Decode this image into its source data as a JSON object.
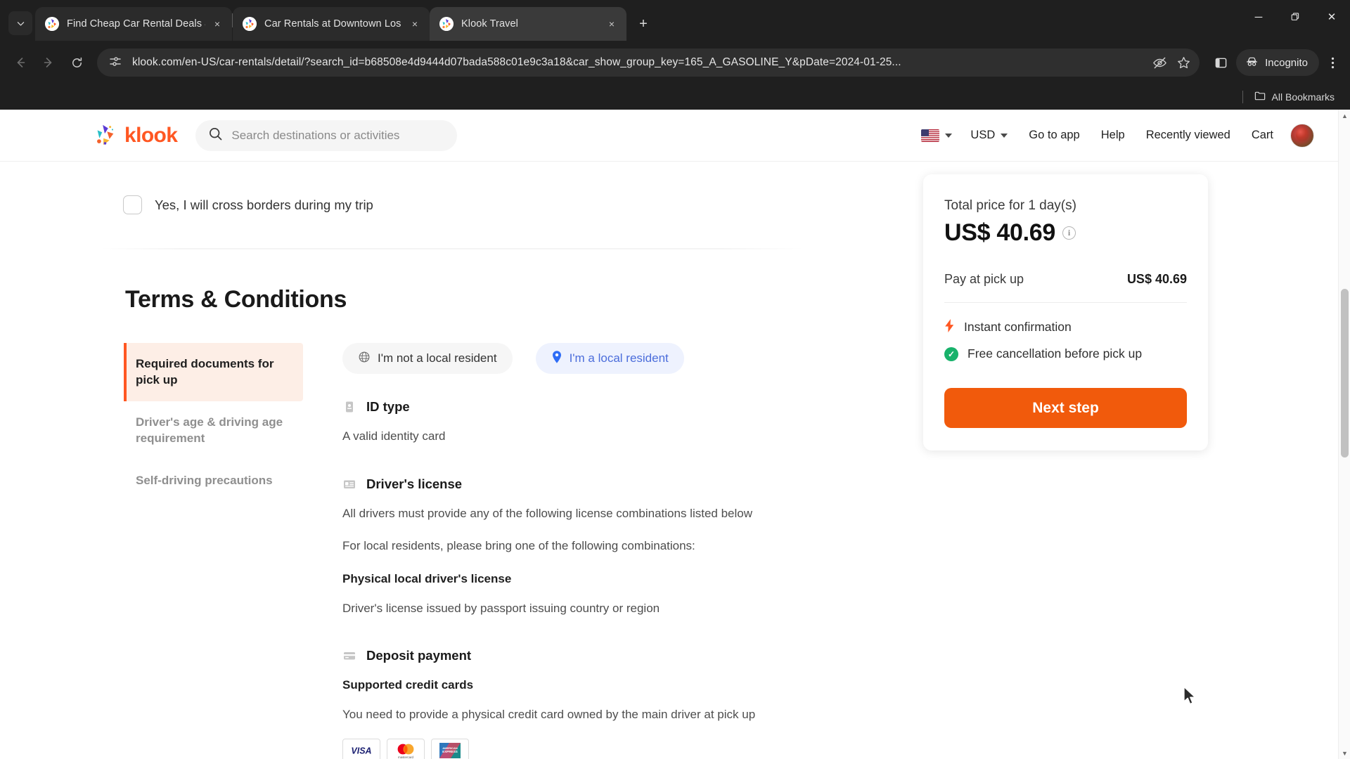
{
  "browser": {
    "tabs": [
      {
        "title": "Find Cheap Car Rental Deals &",
        "close": "×",
        "favicon": "klook-favicon",
        "active": false
      },
      {
        "title": "Car Rentals at Downtown Los A",
        "close": "×",
        "favicon": "klook-favicon",
        "active": false
      },
      {
        "title": "Klook Travel",
        "close": "×",
        "favicon": "klook-favicon",
        "active": true
      }
    ],
    "new_tab_label": "+",
    "tab_list_icon": "chevron-down-icon",
    "window_controls": {
      "minimize": "─",
      "maximize": "❐",
      "close": "✕"
    },
    "toolbar": {
      "back": "←",
      "forward": "→",
      "reload": "⟳",
      "url": "klook.com/en-US/car-rentals/detail/?search_id=b68508e4d9444d07bada588c01e9c3a18&car_show_group_key=165_A_GASOLINE_Y&pDate=2024-01-25...",
      "site_info_icon": "page-settings-icon",
      "tracking_icon": "eye-slash-icon",
      "bookmark_icon": "star-icon",
      "side_panel_icon": "side-panel-icon",
      "incognito_label": "Incognito",
      "incognito_icon": "incognito-hat-icon",
      "menu_icon": "kebab-menu-icon"
    },
    "bookmarks_bar": {
      "label": "All Bookmarks",
      "icon": "folder-icon"
    }
  },
  "site_header": {
    "logo_text": "klook",
    "search_placeholder": "Search destinations or activities",
    "search_icon": "search-icon",
    "flag": "us-flag",
    "currency": "USD",
    "links": [
      "Go to app",
      "Help",
      "Recently viewed",
      "Cart"
    ],
    "avatar": "user-avatar"
  },
  "main": {
    "cross_border": {
      "label": "Yes, I will cross borders during my trip",
      "checked": false
    },
    "terms": {
      "heading": "Terms & Conditions",
      "tabs": [
        {
          "label": "Required documents for pick up",
          "active": true
        },
        {
          "label": "Driver's age & driving age requirement",
          "active": false
        },
        {
          "label": "Self-driving precautions",
          "active": false
        }
      ],
      "resident_toggle": [
        {
          "label": "I'm not a local resident",
          "icon": "globe-icon",
          "selected": false
        },
        {
          "label": "I'm a local resident",
          "icon": "map-pin-icon",
          "selected": true
        }
      ],
      "sections": [
        {
          "icon": "id-card-icon",
          "title": "ID type",
          "paragraphs": [
            {
              "text": "A valid identity card",
              "strong": false
            }
          ]
        },
        {
          "icon": "drivers-license-icon",
          "title": "Driver's license",
          "paragraphs": [
            {
              "text": "All drivers must provide any of the following license combinations listed below",
              "strong": false
            },
            {
              "text": "For local residents, please bring one of the following combinations:",
              "strong": false
            },
            {
              "text": "Physical local driver's license",
              "strong": true
            },
            {
              "text": "Driver's license issued by passport issuing country or region",
              "strong": false
            }
          ]
        },
        {
          "icon": "credit-card-icon",
          "title": "Deposit payment",
          "paragraphs": [
            {
              "text": "Supported credit cards",
              "strong": true
            },
            {
              "text": "You need to provide a physical credit card owned by the main driver at pick up",
              "strong": false
            }
          ],
          "cards": [
            "VISA",
            "Mastercard",
            "American Express"
          ]
        }
      ]
    }
  },
  "price_panel": {
    "total_label": "Total price for 1 day(s)",
    "total_amount": "US$ 40.69",
    "info_icon": "info-icon",
    "pay_label": "Pay at pick up",
    "pay_amount": "US$ 40.69",
    "perks": [
      {
        "icon": "lightning-icon",
        "text": "Instant confirmation"
      },
      {
        "icon": "check-circle-icon",
        "text": "Free cancellation before pick up"
      }
    ],
    "cta": "Next step",
    "accent_color": "#f15a0c"
  },
  "colors": {
    "brand_orange": "#ff5722",
    "cta_orange": "#f15a0c",
    "resident_blue": "#4b6ddb",
    "success_green": "#18b26b",
    "chrome_dark": "#1f1f1f"
  }
}
